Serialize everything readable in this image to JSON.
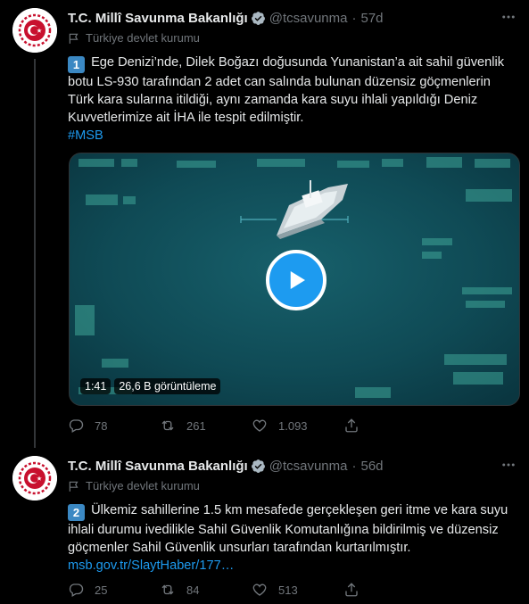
{
  "thread": [
    {
      "name": "T.C. Millî Savunma Bakanlığı",
      "handle": "@tcsavunma",
      "separator": "·",
      "time": "57d",
      "label": "Türkiye devlet kurumu",
      "badge": "1",
      "text": "Ege Denizi’nde, Dilek Boğazı doğusunda Yunanistan’a ait sahil güvenlik botu LS-930 tarafından 2 adet can salında bulunan düzensiz göçmenlerin Türk kara sularına itildiği, aynı zamanda kara suyu ihlali yapıldığı Deniz Kuvvetlerimize ait İHA ile tespit edilmiştir.",
      "hashtag": "#MSB",
      "video": {
        "duration": "1:41",
        "views": "26,6 B görüntüleme"
      },
      "replies": "78",
      "retweets": "261",
      "likes": "1.093"
    },
    {
      "name": "T.C. Millî Savunma Bakanlığı",
      "handle": "@tcsavunma",
      "separator": "·",
      "time": "56d",
      "label": "Türkiye devlet kurumu",
      "badge": "2",
      "text": "Ülkemiz sahillerine 1.5 km mesafede gerçekleşen geri itme ve kara suyu ihlali durumu ivedilikle Sahil Güvenlik Komutanlığına bildirilmiş ve düzensiz göçmenler Sahil Güvenlik unsurları tarafından kurtarılmıştır.",
      "link": "msb.gov.tr/SlaytHaber/177…",
      "replies": "25",
      "retweets": "84",
      "likes": "513"
    }
  ],
  "colors": {
    "background": "#000000",
    "text": "#e7e9ea",
    "secondary": "#71767b",
    "accent": "#1d9bf0",
    "avatar_red": "#c8102e"
  },
  "icons": [
    "verified-badge-icon",
    "more-icon",
    "flag-icon",
    "play-icon",
    "reply-icon",
    "retweet-icon",
    "like-icon",
    "share-icon"
  ]
}
